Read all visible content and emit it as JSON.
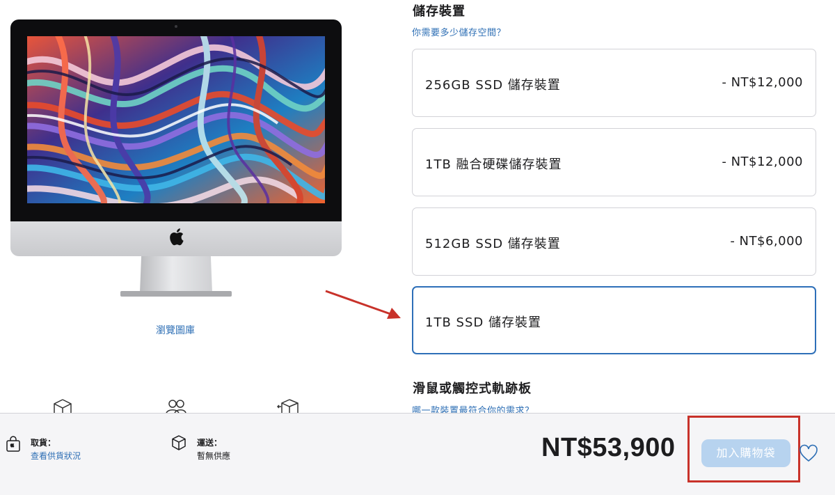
{
  "product": {
    "gallery_link": "瀏覽圖庫"
  },
  "storage": {
    "title": "儲存裝置",
    "help": "你需要多少儲存空間？",
    "options": [
      {
        "name": "256GB SSD 儲存裝置",
        "price": "- NT$12,000"
      },
      {
        "name": "1TB 融合硬碟儲存裝置",
        "price": "- NT$12,000"
      },
      {
        "name": "512GB SSD 儲存裝置",
        "price": "- NT$6,000"
      },
      {
        "name": "1TB SSD 儲存裝置",
        "price": "",
        "selected": true
      }
    ]
  },
  "mouse": {
    "title": "滑鼠或觸控式軌跡板",
    "help": "哪一款裝置最符合你的需求？"
  },
  "bar": {
    "pickup_label": "取貨：",
    "pickup_link": "查看供貨狀況",
    "shipping_label": "運送：",
    "shipping_status": "暫無供應",
    "total": "NT$53,900",
    "add_to_bag": "加入購物袋"
  },
  "colors": {
    "link": "#2e6fb5",
    "selected_border": "#2d6fb8",
    "annotation_red": "#c8322a",
    "button_disabled": "#b7d3ef"
  },
  "icons": [
    "apple-logo-icon",
    "box-icon",
    "people-icon",
    "trade-in-icon",
    "bag-icon",
    "heart-icon"
  ]
}
